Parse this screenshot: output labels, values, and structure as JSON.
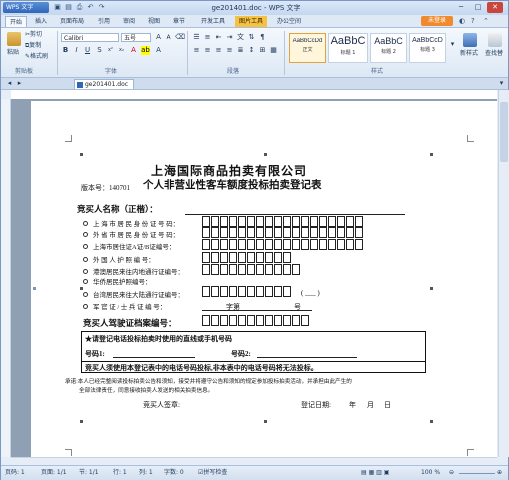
{
  "window": {
    "app_button": "WPS 文字",
    "title": "ge201401.doc - WPS 文字",
    "login_button": "未登录",
    "minimize": "─",
    "maximize": "□",
    "close": "✕"
  },
  "menu_tabs": [
    "开始",
    "插入",
    "页面布局",
    "引用",
    "审阅",
    "视图",
    "章节",
    "开发工具",
    "图片工具",
    "办公空间"
  ],
  "ribbon": {
    "paste_label": "粘贴",
    "cut_label": "剪切",
    "copy_label": "复制",
    "format_painter_label": "格式刷",
    "font_name": "Calibri",
    "font_size": "五号",
    "group_clipboard": "剪贴板",
    "group_font": "字体",
    "group_paragraph": "段落",
    "group_styles": "样式",
    "new_style_label": "新样式",
    "find_label": "查找替",
    "styles": [
      {
        "sample": "AaBbCcDd",
        "name": "正文"
      },
      {
        "sample": "AaBbC",
        "name": "标题 1"
      },
      {
        "sample": "AaBbC",
        "name": "标题 2"
      },
      {
        "sample": "AaBbCcD",
        "name": "标题 3"
      }
    ]
  },
  "doc_tab": "ge201401.doc",
  "document": {
    "title_line1": "上海国际商品拍卖有限公司",
    "title_line2": "个人非营业性客车额度投标拍卖登记表",
    "version_label": "版本号：140701",
    "bidder_name_label": "竞买人名称（正楷）：",
    "id_rows": [
      {
        "label": "上 海 市 居 民 身 份 证 号 码：",
        "boxes": 18
      },
      {
        "label": "外 省 市 居 民 身 份 证 号 码：",
        "boxes": 18
      },
      {
        "label": "上海市居住证A证/B证编号：",
        "boxes": 18
      },
      {
        "label": "外  国  人  护  照  编  号：",
        "boxes": 10
      },
      {
        "label": "港澳居民来往内地通行证编号：",
        "boxes": 11
      },
      {
        "label": "华侨居民护照编号：",
        "boxes": 0
      },
      {
        "label": "台湾居民来往大陆通行证编号：",
        "boxes": 10
      },
      {
        "label": "军 官 证 / 士 兵 证 编 号：",
        "boxes": 0
      }
    ],
    "military_zi": "字第",
    "military_hao": "号",
    "taiwan_paren": "( ___ )",
    "driver_label": "竞买人驾驶证档案编号：",
    "driver_boxes": 12,
    "phone_note": "★请登记电话投标拍卖时使用的直线或手机号码",
    "phone1_label": "号码1:",
    "phone2_label": "号码2:",
    "phone_warning": "竞买人须使用本登记表中的电话号码投标,非本表中的电话号码将无法投标。",
    "promise_line1": "承诺:本人已经完整阅读投标拍卖公告和须知，接受并将遵守公告和须知的规定参加投标拍卖活动，并承担由此产生的",
    "promise_line2": "全部法律责任，同意接收拍卖人发送的相关拍卖信息。",
    "signature_label": "竞买人签章:",
    "date_label": "登记日期:",
    "year": "年",
    "month": "月",
    "day": "日"
  },
  "statusbar": {
    "page": "页码: 1",
    "pages": "页面: 1/1",
    "section": "节: 1/1",
    "row": "行: 1",
    "col": "列: 1",
    "words": "字数: 0",
    "spell": "拼写检查",
    "zoom": "100 %"
  },
  "colors": {
    "titlebar": "#c4d7ef",
    "picture_tools_tab": "#f6c244",
    "login_button": "#f08a2c",
    "canvas_background": "#8f9fb4"
  }
}
